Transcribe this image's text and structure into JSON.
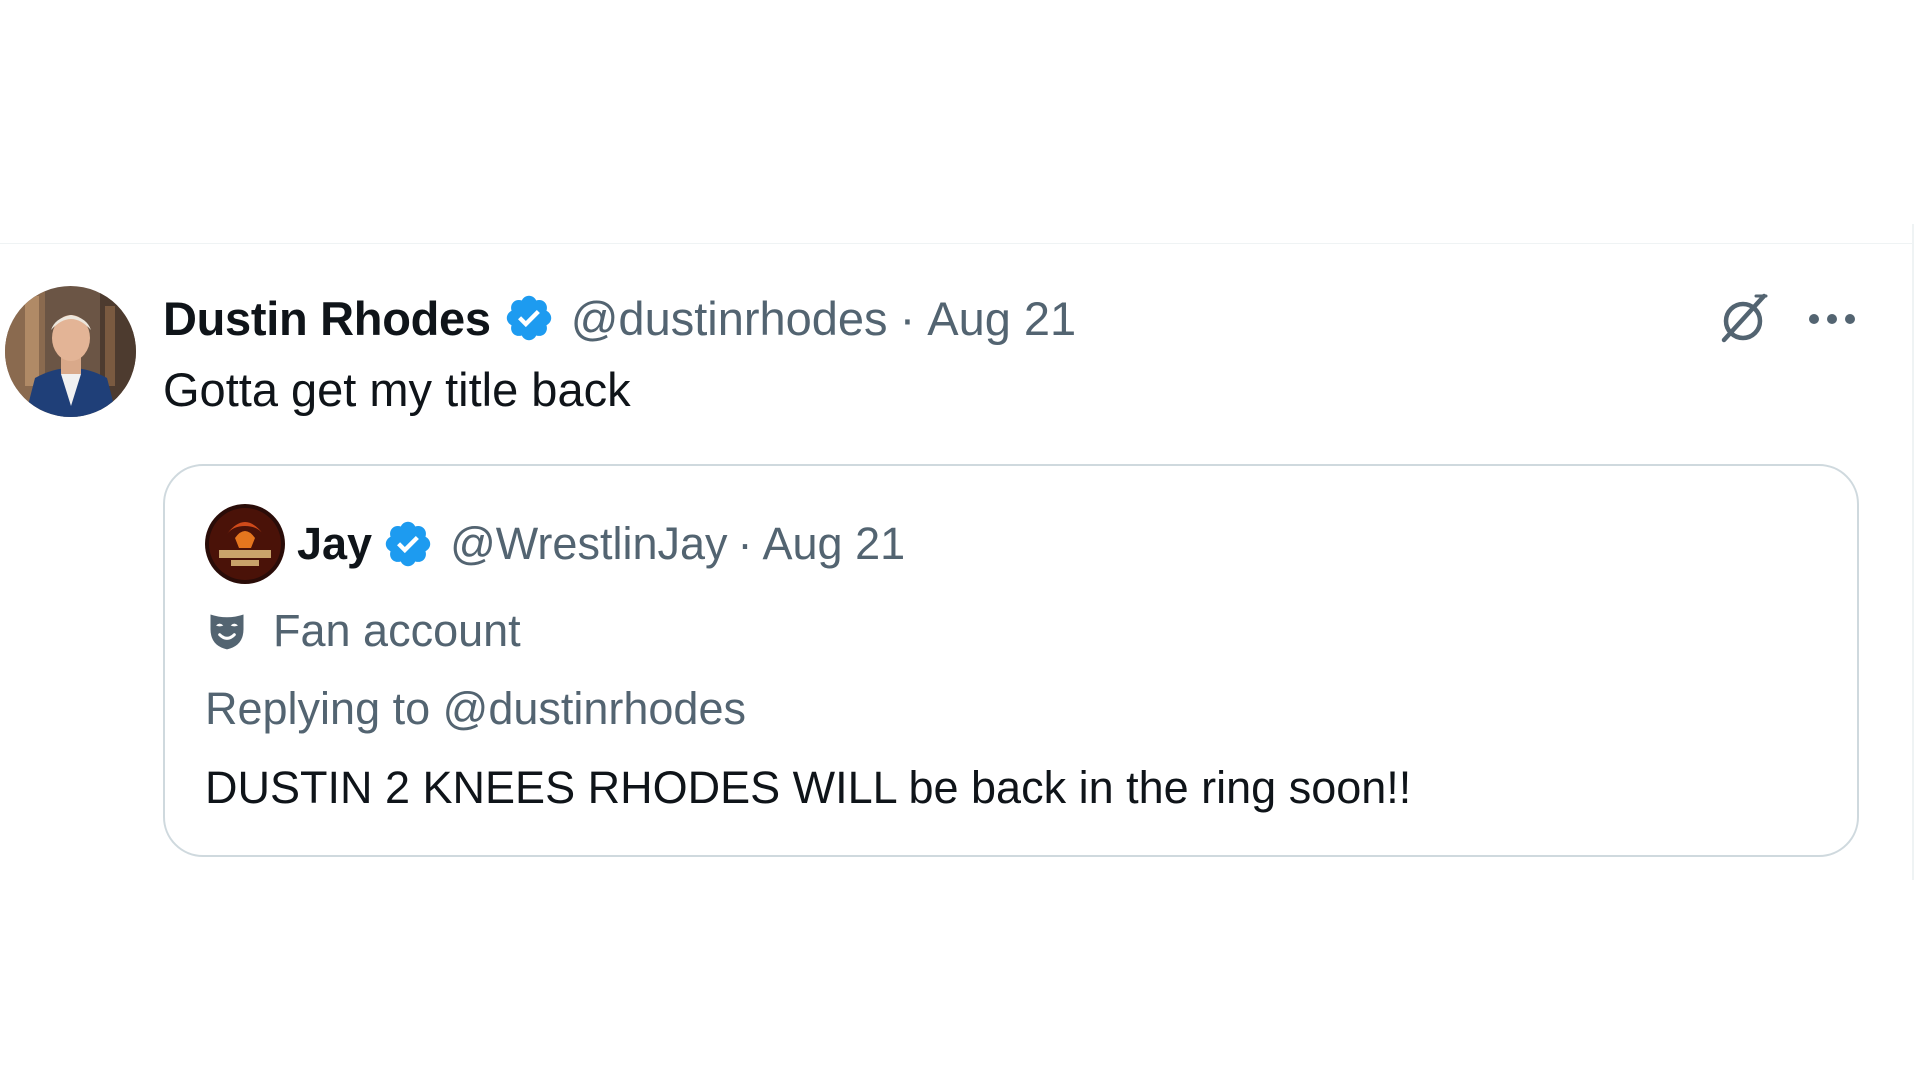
{
  "tweet": {
    "author": {
      "display_name": "Dustin Rhodes",
      "handle": "@dustinrhodes",
      "verified": true
    },
    "separator": "·",
    "timestamp": "Aug 21",
    "text": "Gotta get my title back",
    "actions": {
      "grok_icon": "grok-slash-icon",
      "more_icon": "more-options-icon"
    },
    "quoted_tweet": {
      "author": {
        "display_name": "Jay",
        "handle": "@WrestlinJay",
        "verified": true
      },
      "separator": "·",
      "timestamp": "Aug 21",
      "label": "Fan account",
      "label_icon": "theater-mask-icon",
      "replying_to": "Replying to @dustinrhodes",
      "text": "DUSTIN 2 KNEES RHODES WILL be back in the ring soon!!"
    }
  },
  "colors": {
    "verified_blue": "#1d9bf0",
    "secondary_text": "#536471",
    "primary_text": "#0f1419",
    "border": "#cfd9de"
  }
}
